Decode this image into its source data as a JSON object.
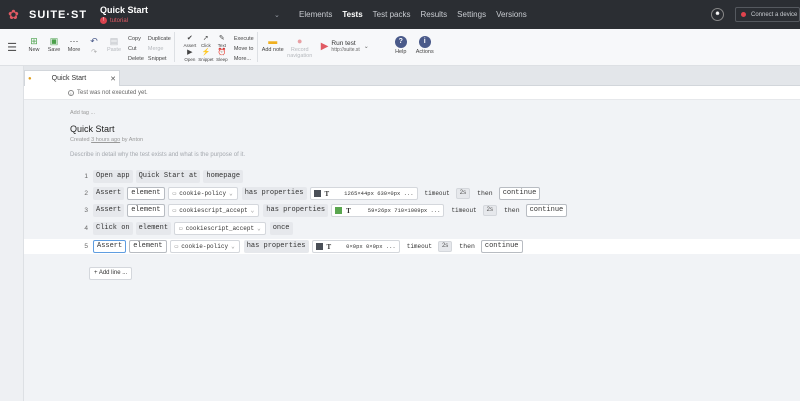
{
  "app": {
    "name": "SUITE·ST"
  },
  "project": {
    "title": "Quick Start",
    "branch": "tutorial"
  },
  "nav": [
    "Elements",
    "Tests",
    "Test packs",
    "Results",
    "Settings",
    "Versions"
  ],
  "connect": {
    "label": "Connect a device"
  },
  "toolbar": {
    "new": "New",
    "save": "Save",
    "more": "More",
    "paste": "Paste",
    "copy": "Copy",
    "cut": "Cut",
    "delete": "Delete",
    "duplicate": "Duplicate",
    "merge": "Merge",
    "snippet": "Snippet",
    "assert": "Assert",
    "click": "Click",
    "text": "Text",
    "open": "Open",
    "snippet2": "Snippet",
    "sleep": "Sleep",
    "execute": "Execute",
    "move_to": "Move to",
    "more2": "More...",
    "add_note": "Add note",
    "record": "Record navigation",
    "run_test": "Run test",
    "run_url": "http://suite.st",
    "help": "Help",
    "actions": "Actions"
  },
  "tab": {
    "label": "Quick Start"
  },
  "banner": "Test was not executed yet.",
  "test": {
    "add_tag": "Add tag ...",
    "title": "Quick Start",
    "created_prefix": "Created ",
    "created_time": "3 hours ago",
    "created_suffix": " by Anton",
    "description": "Describe in detail why the test exists and what is the purpose of it."
  },
  "lines": [
    {
      "n": "1",
      "a": "Open app",
      "b": "Quick Start at",
      "c": "homepage"
    },
    {
      "n": "2",
      "a": "Assert",
      "b": "element",
      "page": "cookie-policy",
      "c": "has properties",
      "size": "1265×44px",
      "pos": "630×0px",
      "d": "timeout",
      "t": "2s",
      "e": "then",
      "f": "continue"
    },
    {
      "n": "3",
      "a": "Assert",
      "b": "element",
      "page": "cookiescript_accept",
      "c": "has properties",
      "size": "59×26px",
      "pos": "710×1009px",
      "d": "timeout",
      "t": "2s",
      "e": "then",
      "f": "continue"
    },
    {
      "n": "4",
      "a": "Click on",
      "b": "element",
      "page": "cookiescript_accept",
      "c": "once"
    },
    {
      "n": "5",
      "a": "Assert",
      "b": "element",
      "page": "cookie-policy",
      "c": "has properties",
      "size": "0×0px",
      "pos": "0×0px",
      "d": "timeout",
      "t": "2s",
      "e": "then",
      "f": "continue"
    }
  ],
  "add_line": "Add line ...",
  "colors": {
    "accent": "#e05a63",
    "topbar": "#2b2e33",
    "swatch_dark": "#4a4f57",
    "swatch_green": "#5aa64f"
  }
}
